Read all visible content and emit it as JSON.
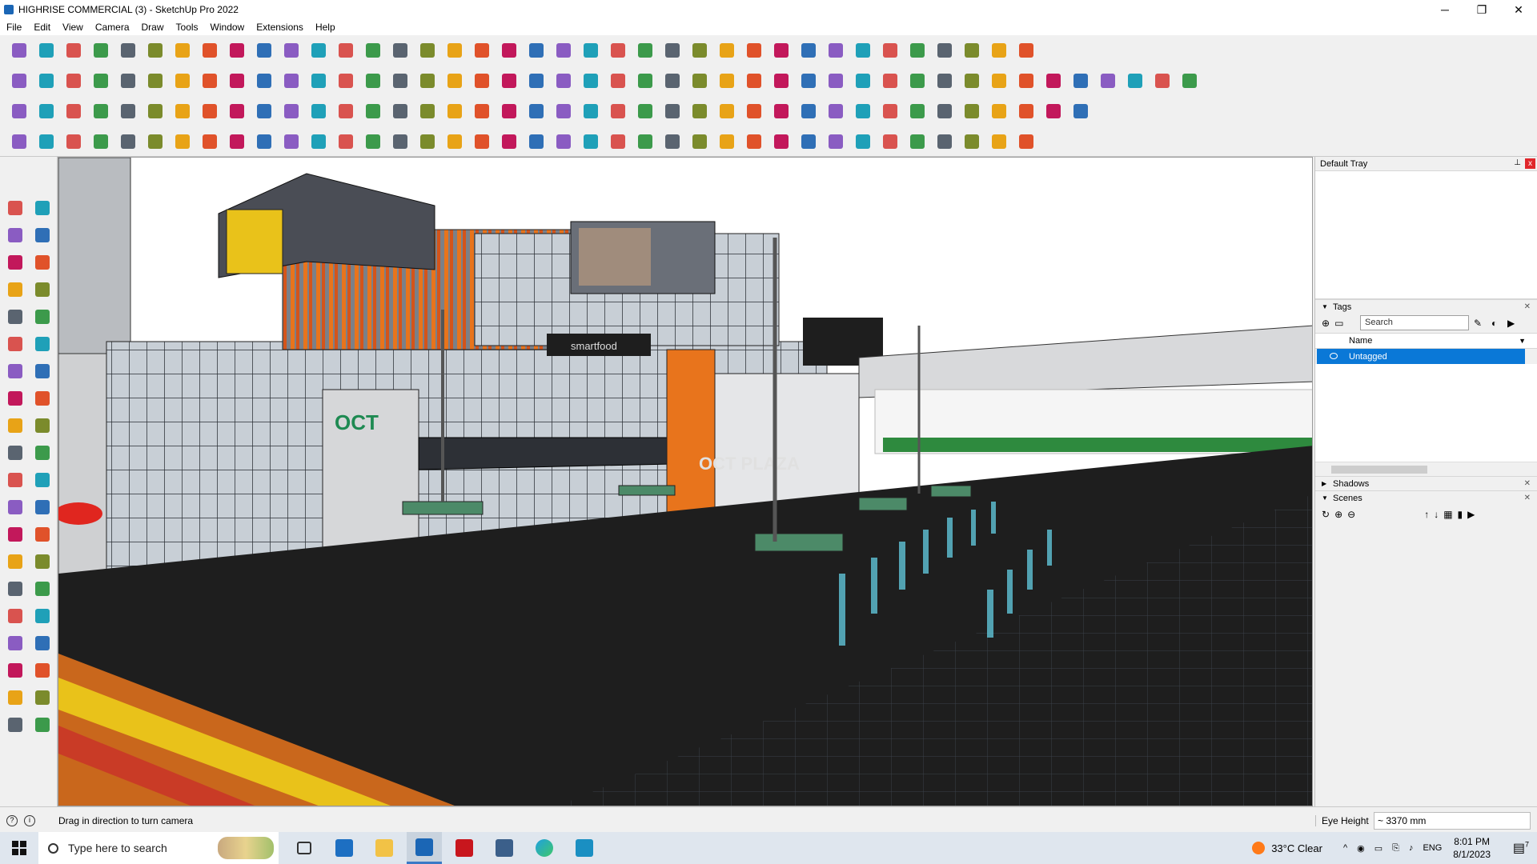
{
  "window": {
    "title": "HIGHRISE COMMERCIAL (3) - SketchUp Pro 2022",
    "minimize": "─",
    "maximize": "❐",
    "close": "✕"
  },
  "menu": [
    "File",
    "Edit",
    "View",
    "Camera",
    "Draw",
    "Tools",
    "Window",
    "Extensions",
    "Help"
  ],
  "viewport": {
    "sign_oct": "OCT",
    "sign_plaza": "OCT PLAZA",
    "sign_smartfood": "smartfood"
  },
  "tray": {
    "title": "Default Tray",
    "pin": "⊥",
    "close": "x",
    "tags": {
      "header": "Tags",
      "search_placeholder": "Search",
      "column": "Name",
      "rows": [
        "Untagged"
      ]
    },
    "shadows": {
      "header": "Shadows"
    },
    "scenes": {
      "header": "Scenes"
    }
  },
  "status": {
    "hint": "Drag in direction to turn camera",
    "measure_label": "Eye Height",
    "measure_value": "~ 3370 mm"
  },
  "taskbar": {
    "search_placeholder": "Type here to search",
    "weather_temp": "33°C",
    "weather_desc": "Clear",
    "lang": "ENG",
    "time": "8:01 PM",
    "date": "8/1/2023",
    "notif_count": "7"
  },
  "colors": {
    "accent": "#0a78d7",
    "facade_orange": "#e8741c",
    "facade_yellow": "#e9c21a",
    "grass": "#2e8a3e",
    "road": "#1e1e1e"
  }
}
